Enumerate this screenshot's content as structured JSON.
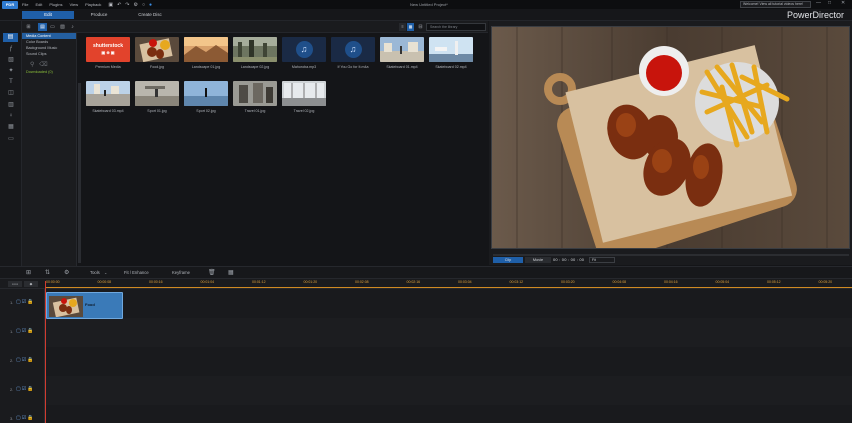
{
  "menubar": {
    "logo": "PDR",
    "items": [
      "File",
      "Edit",
      "Plugins",
      "View",
      "Playback"
    ],
    "doc_title": "New Untitled Project*",
    "notice": "Welcome! View all tutorial videos here!",
    "window_controls": [
      "—",
      "□",
      "✕"
    ]
  },
  "rooms": {
    "tabs": [
      "Edit",
      "Produce",
      "Create Disc"
    ],
    "active": "Edit",
    "brand": "PowerDirector"
  },
  "library": {
    "search_placeholder": "Search the library",
    "categories": [
      "Media Content",
      "Color Boards",
      "Background Music",
      "Sound Clips"
    ],
    "active_category": "Media Content",
    "downloaded_label": "Downloaded (0)",
    "items": [
      {
        "name": "Premium Media",
        "kind": "shutterstock",
        "brand_text": "shutterstock"
      },
      {
        "name": "Food.jpg",
        "kind": "food"
      },
      {
        "name": "Landscape 01.jpg",
        "kind": "landscape1"
      },
      {
        "name": "Landscape 02.jpg",
        "kind": "landscape2"
      },
      {
        "name": "Mahoroba.mp3",
        "kind": "audio"
      },
      {
        "name": "If You Go for It.m4a",
        "kind": "audio"
      },
      {
        "name": "Skateboard 01.mp4",
        "kind": "skate1"
      },
      {
        "name": "Skateboard 02.mp4",
        "kind": "skate2"
      },
      {
        "name": "Skateboard 03.mp4",
        "kind": "skate3"
      },
      {
        "name": "Sport 01.jpg",
        "kind": "sport1"
      },
      {
        "name": "Sport 02.jpg",
        "kind": "sport2"
      },
      {
        "name": "Travel 01.jpg",
        "kind": "travel1"
      },
      {
        "name": "Travel 02.jpg",
        "kind": "travel2"
      }
    ]
  },
  "preview": {
    "mode_clip": "Clip",
    "mode_movie": "Movie",
    "timecode": "00 : 00 : 00 : 00",
    "fit": "Fit"
  },
  "timeline": {
    "tools": [
      "Tools",
      "Fit / Enhance",
      "Keyframe"
    ],
    "ruler_ticks": [
      "00:00:00",
      "00:00:08",
      "00:00:16",
      "00:01:04",
      "00:01:12",
      "00:01:20",
      "00:02:08",
      "00:02:16",
      "00:03:04",
      "00:03:12",
      "00:03:20",
      "00:04:08",
      "00:04:16",
      "00:05:04",
      "00:05:12",
      "00:05:20"
    ],
    "track_numbers": [
      "1.",
      "1.",
      "2.",
      "2.",
      "3."
    ],
    "clip_label": "Food"
  },
  "colors": {
    "accent": "#1f5fa8",
    "playhead": "#d23b2f",
    "ruler": "#d08a22",
    "clip": "#3a7ab8"
  }
}
